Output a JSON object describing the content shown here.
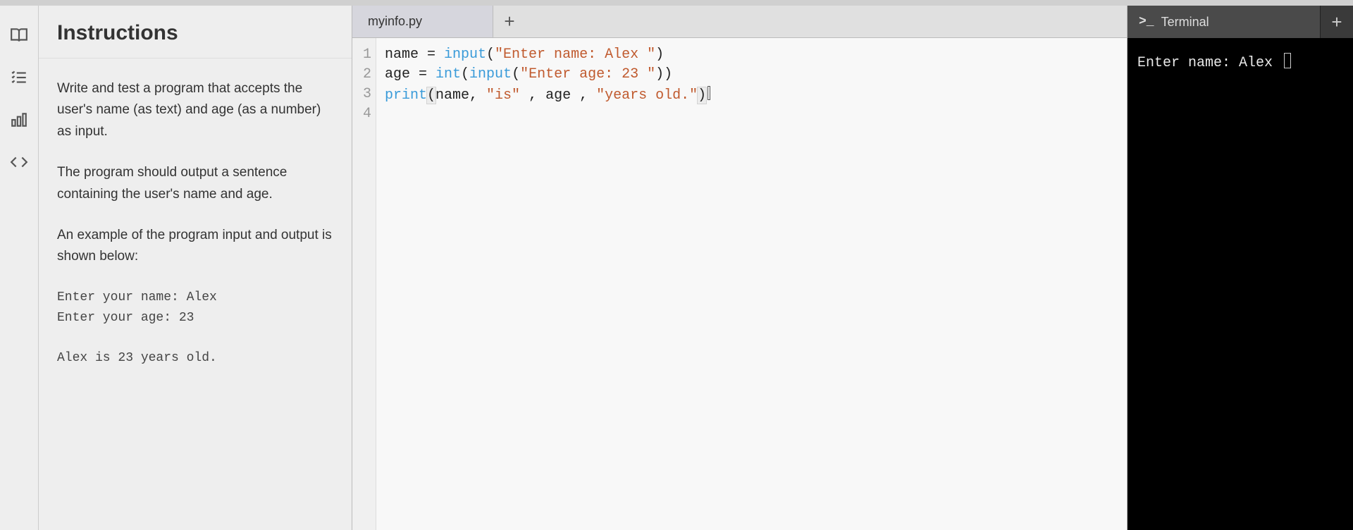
{
  "instructions": {
    "title": "Instructions",
    "p1": "Write and test a program that accepts the user's name (as text) and age (as a number) as input.",
    "p2": "The program should output a sentence containing the user's name and age.",
    "p3": "An example of the program input and output is shown below:",
    "example": "Enter your name: Alex\nEnter your age: 23\n\nAlex is 23 years old."
  },
  "sidebar": {
    "icons": [
      "book-icon",
      "checklist-icon",
      "chart-icon",
      "code-icon"
    ]
  },
  "editor": {
    "tab": "myinfo.py",
    "add": "+",
    "lines": [
      {
        "ln": "1",
        "tokens": [
          {
            "t": "name = ",
            "c": ""
          },
          {
            "t": "input",
            "c": "tok-fn"
          },
          {
            "t": "(",
            "c": ""
          },
          {
            "t": "\"Enter name: Alex \"",
            "c": "tok-str"
          },
          {
            "t": ")",
            "c": ""
          }
        ]
      },
      {
        "ln": "2",
        "tokens": [
          {
            "t": "age = ",
            "c": ""
          },
          {
            "t": "int",
            "c": "tok-fn"
          },
          {
            "t": "(",
            "c": ""
          },
          {
            "t": "input",
            "c": "tok-fn"
          },
          {
            "t": "(",
            "c": ""
          },
          {
            "t": "\"Enter age: 23 \"",
            "c": "tok-str"
          },
          {
            "t": "))",
            "c": ""
          }
        ]
      },
      {
        "ln": "3",
        "tokens": [
          {
            "t": "print",
            "c": "tok-fn"
          },
          {
            "t": "(",
            "c": "bracket-hl"
          },
          {
            "t": "name, ",
            "c": ""
          },
          {
            "t": "\"is\"",
            "c": "tok-str"
          },
          {
            "t": " , age , ",
            "c": ""
          },
          {
            "t": "\"years old.\"",
            "c": "tok-str"
          },
          {
            "t": ")",
            "c": "bracket-hl"
          }
        ]
      },
      {
        "ln": "4",
        "tokens": []
      }
    ]
  },
  "terminal": {
    "tab": "Terminal",
    "prompt_symbol": ">_",
    "add": "+",
    "line1": "Enter name: Alex "
  }
}
